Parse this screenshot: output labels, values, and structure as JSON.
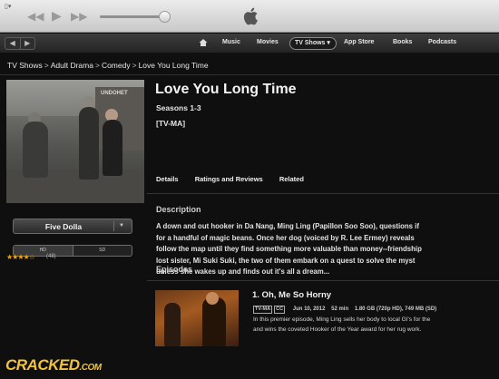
{
  "window": {
    "menu_label": "▯▾"
  },
  "transport": {
    "prev_icon": "rewind-icon",
    "play_icon": "play-icon",
    "next_icon": "fast-forward-icon"
  },
  "nav": {
    "back_icon": "back-arrow-icon",
    "forward_icon": "forward-arrow-icon",
    "home_icon": "home-icon",
    "items": [
      "Music",
      "Movies",
      "TV Shows ▾",
      "App Store",
      "Books",
      "Podcasts"
    ],
    "active": "TV Shows ▾"
  },
  "breadcrumb": [
    "TV Shows",
    "Adult Drama",
    "Comedy",
    "Love You Long Time"
  ],
  "show": {
    "title": "Love You Long Time",
    "seasons": "Seasons 1-3",
    "rating": "[TV-MA]",
    "poster_sign": "UNDOHET"
  },
  "buy": {
    "price_label": "Five Dolla",
    "format_hd": "HD",
    "format_sd": "SD",
    "stars": "★★★★☆",
    "rating_count": "(48)"
  },
  "tabs": [
    "Details",
    "Ratings and Reviews",
    "Related"
  ],
  "description": {
    "heading": "Description",
    "lines": [
      "A down and out hooker in Da Nang, Ming Ling (Papillon Soo Soo), questions if",
      "for a handful of magic beans. Once her dog (voiced by R. Lee Ermey) reveals",
      "follow the map until they find something more valuable than money--friendship",
      "lost sister, Mi Suki Suki, the two of them embark on a quest to solve the myst",
      "unless she wakes up and finds out it's all a dream..."
    ]
  },
  "episodes": {
    "heading": "Episodes",
    "items": [
      {
        "title": "1. Oh, Me So Horny",
        "badges": [
          "TV-MA",
          "CC"
        ],
        "date": "Jun 10, 2012",
        "duration": "52 min",
        "size": "1.80 GB (720p HD), 749 MB (SD)",
        "desc_lines": [
          "In this premier episode, Ming Ling sells her body to local GI's for the",
          "and wins the coveted Hooker of the Year award for her rug work."
        ]
      }
    ]
  },
  "watermark": {
    "main": "CRACKED",
    "suffix": ".COM"
  }
}
